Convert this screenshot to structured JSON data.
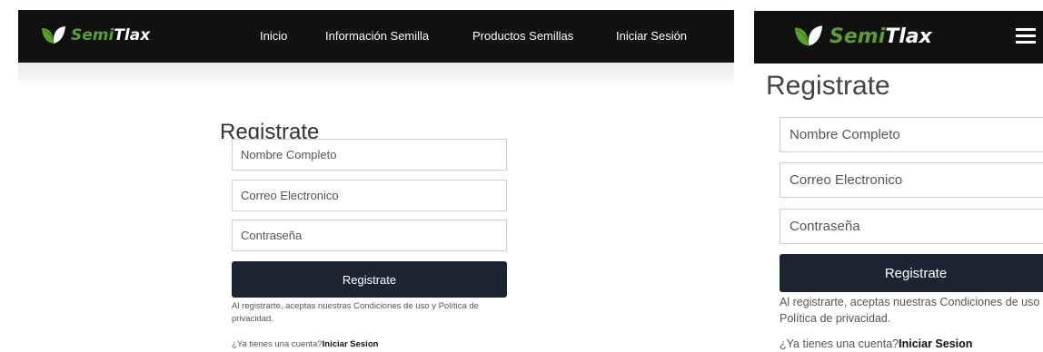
{
  "brand": {
    "name_part1": "Semi",
    "name_part2": "Tlax",
    "leaf_color": "#5aa02c",
    "nav_bg": "#111111"
  },
  "nav": {
    "items": [
      {
        "label": "Inicio"
      },
      {
        "label": "Información Semilla"
      },
      {
        "label": "Productos Semillas"
      },
      {
        "label": "Iniciar Sesión"
      }
    ],
    "menu_icon": "hamburger-menu-icon"
  },
  "form": {
    "title": "Registrate",
    "name_placeholder": "Nombre Completo",
    "email_placeholder": "Correo Electronico",
    "password_placeholder": "Contraseña",
    "submit_label": "Registrate",
    "button_color": "#1c2534",
    "terms_text": "Al registrarte, aceptas nuestras Condiciones de uso y Política de privacidad.",
    "have_account_text": "¿Ya tienes una cuenta?",
    "login_link": "Iniciar Sesion"
  }
}
